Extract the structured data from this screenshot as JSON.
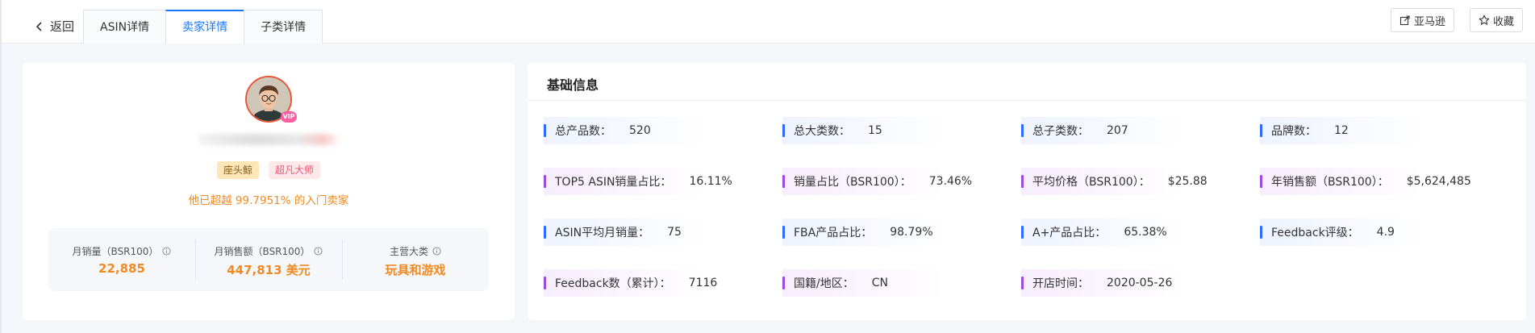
{
  "nav": {
    "back_label": "返回",
    "tabs": [
      {
        "label": "ASIN详情",
        "active": false
      },
      {
        "label": "卖家详情",
        "active": true
      },
      {
        "label": "子类详情",
        "active": false
      }
    ],
    "amazon_label": "亚马逊",
    "favorite_label": "收藏"
  },
  "seller": {
    "badge": "VIP",
    "tags": [
      "座头鲸",
      "超凡大师"
    ],
    "exceed_text": "他已超越 99.7951% 的入门卖家",
    "stats": [
      {
        "label": "月销量（BSR100）",
        "value": "22,885"
      },
      {
        "label": "月销售额（BSR100）",
        "value": "447,813 美元"
      },
      {
        "label": "主营大类",
        "value": "玩具和游戏"
      }
    ]
  },
  "basic_info": {
    "title": "基础信息",
    "rows": [
      [
        {
          "label": "总产品数：",
          "value": "520",
          "accent": "blue"
        },
        {
          "label": "总大类数：",
          "value": "15",
          "accent": "blue"
        },
        {
          "label": "总子类数：",
          "value": "207",
          "accent": "blue"
        },
        {
          "label": "品牌数：",
          "value": "12",
          "accent": "blue"
        }
      ],
      [
        {
          "label": "TOP5 ASIN销量占比：",
          "value": "16.11%",
          "accent": "purple"
        },
        {
          "label": "销量占比（BSR100）：",
          "value": "73.46%",
          "accent": "purple"
        },
        {
          "label": "平均价格（BSR100）：",
          "value": "$25.88",
          "accent": "purple"
        },
        {
          "label": "年销售额（BSR100）：",
          "value": "$5,624,485",
          "accent": "purple"
        }
      ],
      [
        {
          "label": "ASIN平均月销量：",
          "value": "75",
          "accent": "blue"
        },
        {
          "label": "FBA产品占比：",
          "value": "98.79%",
          "accent": "blue"
        },
        {
          "label": "A+产品占比：",
          "value": "65.38%",
          "accent": "blue"
        },
        {
          "label": "Feedback评级：",
          "value": "4.9",
          "accent": "blue"
        }
      ],
      [
        {
          "label": "Feedback数（累计）：",
          "value": "7116",
          "accent": "purple"
        },
        {
          "label": "国籍/地区：",
          "value": "CN",
          "accent": "purple"
        },
        {
          "label": "开店时间：",
          "value": "2020-05-26",
          "accent": "purple"
        }
      ]
    ]
  },
  "colors": {
    "accent_blue": "#1677ff",
    "orange": "#f08a24",
    "bar_blue": "#2f6bff",
    "bar_purple": "#a04be0"
  }
}
